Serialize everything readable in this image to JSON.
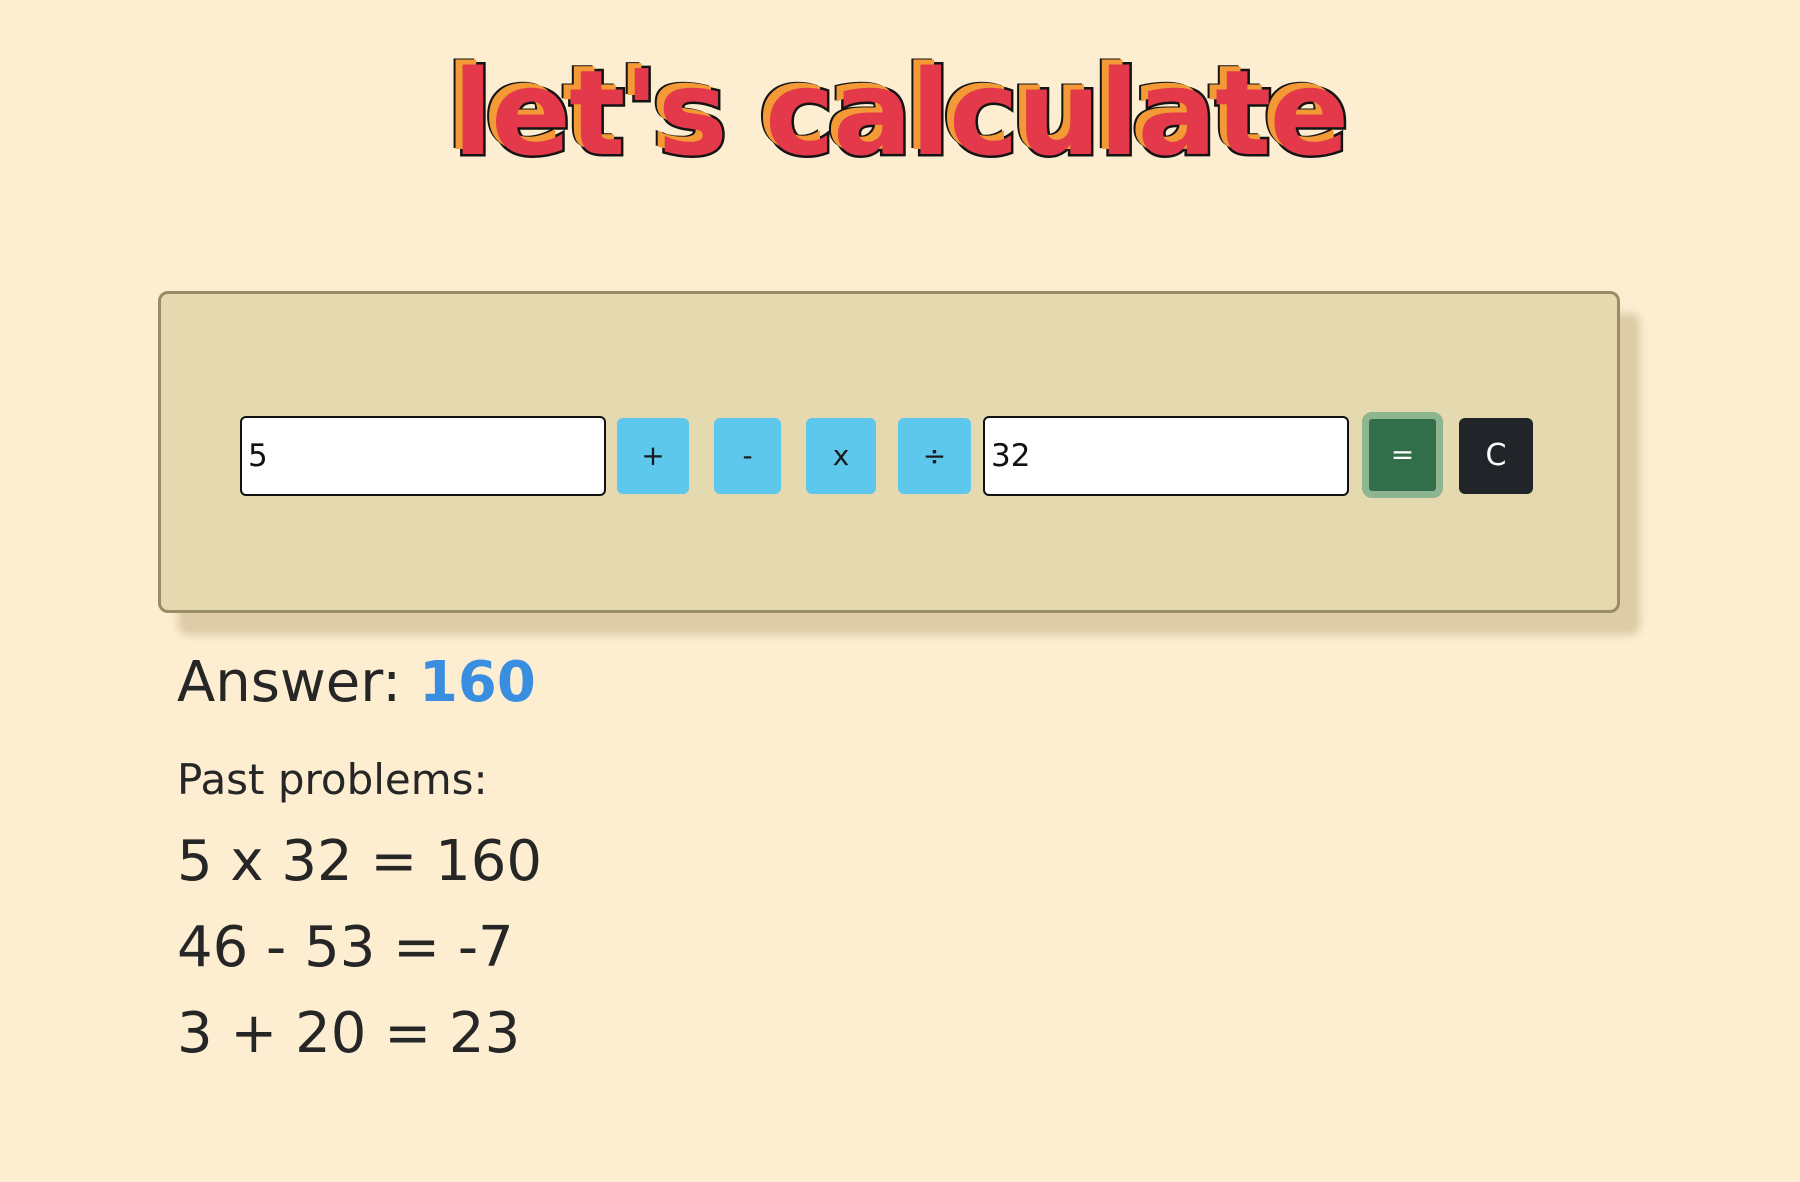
{
  "header": {
    "title": "let's calculate"
  },
  "calculator": {
    "first_value": "5",
    "second_value": "32",
    "ops": {
      "plus": "+",
      "minus": "-",
      "times": "x",
      "divide": "÷"
    },
    "equals_label": "=",
    "clear_label": "C"
  },
  "answer": {
    "label": "Answer:",
    "value": "160"
  },
  "past": {
    "heading": "Past problems:",
    "items": [
      "5 x 32 = 160",
      "46 - 53 = -7",
      "3 + 20 = 23"
    ]
  },
  "colors": {
    "background": "#fdeed1",
    "panel": "#e5d9b0",
    "operator_button": "#5ec8ec",
    "equals_button": "#336e4a",
    "clear_button": "#212529",
    "answer_value": "#3a8ee0",
    "title_fill": "#e3394a",
    "title_shadow": "#f39a36"
  }
}
